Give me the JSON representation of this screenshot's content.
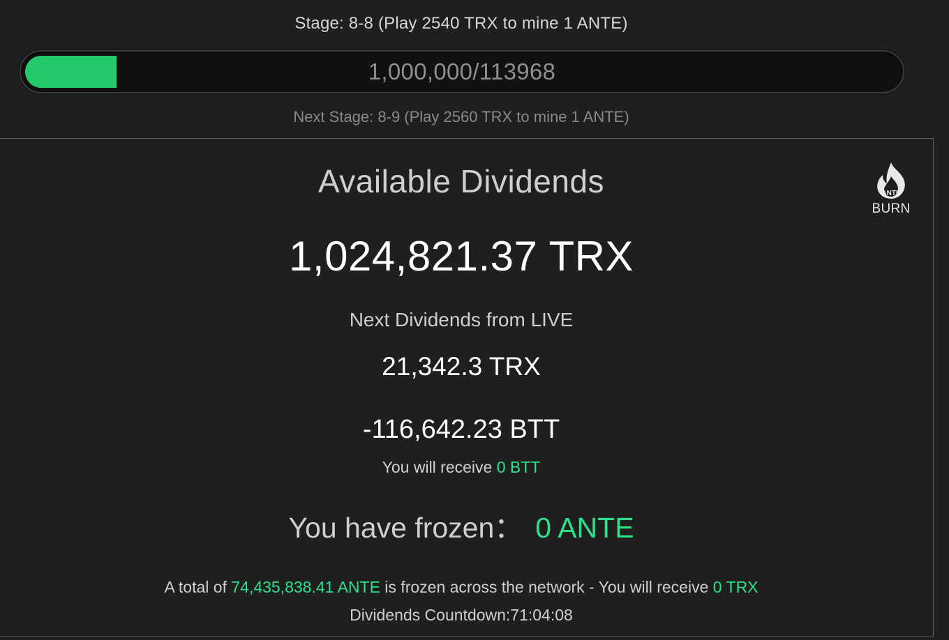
{
  "stage": {
    "current": "Stage: 8-8 (Play 2540 TRX to mine 1 ANTE)",
    "progress_text": "1,000,000/113968",
    "progress_fraction": 0.105,
    "next": "Next Stage: 8-9 (Play 2560 TRX to mine 1 ANTE)"
  },
  "dividends": {
    "title": "Available Dividends",
    "available_amount": "1,024,821.37 TRX",
    "next_label": "Next Dividends from LIVE",
    "next_trx": "21,342.3 TRX",
    "next_btt": "-116,642.23 BTT",
    "receive_btt_prefix": "You will receive ",
    "receive_btt_value": "0 BTT",
    "frozen_prefix": "You have frozen：",
    "frozen_value": "0 ANTE",
    "network_prefix": "A total of ",
    "network_total": "74,435,838.41 ANTE",
    "network_middle": " is frozen across the network - You will receive ",
    "network_receive": "0 TRX",
    "countdown": "Dividends Countdown:71:04:08"
  },
  "burn": {
    "icon": "flame-icon",
    "icon_text": "ANTE",
    "label": "BURN"
  },
  "colors": {
    "accent_green": "#2ee08a",
    "progress_green": "#23c96a",
    "background": "#1f1f1f"
  }
}
